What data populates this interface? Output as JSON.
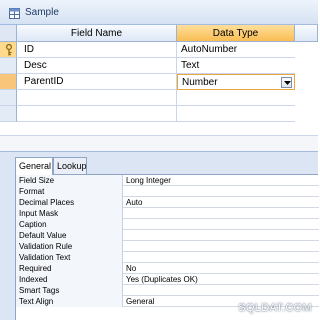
{
  "window": {
    "title": "Sample"
  },
  "grid": {
    "headers": {
      "field_name": "Field Name",
      "data_type": "Data Type"
    },
    "rows": [
      {
        "field": "ID",
        "type": "AutoNumber",
        "primary_key": true
      },
      {
        "field": "Desc",
        "type": "Text"
      },
      {
        "field": "ParentID",
        "type": "Number",
        "editing": true
      }
    ]
  },
  "properties": {
    "tabs": {
      "general": "General",
      "lookup": "Lookup"
    },
    "rows": [
      {
        "name": "Field Size",
        "value": "Long Integer"
      },
      {
        "name": "Format",
        "value": ""
      },
      {
        "name": "Decimal Places",
        "value": "Auto"
      },
      {
        "name": "Input Mask",
        "value": ""
      },
      {
        "name": "Caption",
        "value": ""
      },
      {
        "name": "Default Value",
        "value": ""
      },
      {
        "name": "Validation Rule",
        "value": ""
      },
      {
        "name": "Validation Text",
        "value": ""
      },
      {
        "name": "Required",
        "value": "No"
      },
      {
        "name": "Indexed",
        "value": "Yes (Duplicates OK)"
      },
      {
        "name": "Smart Tags",
        "value": ""
      },
      {
        "name": "Text Align",
        "value": "General"
      }
    ]
  },
  "watermark": "SQLDAT.COM",
  "colors": {
    "header_active": "#f9bd53",
    "row_selector_active": "#f8c57a",
    "edit_border": "#e8a63f"
  },
  "icons": {
    "window": "table-icon",
    "primary_key": "key-icon",
    "dropdown": "chevron-down-icon"
  }
}
